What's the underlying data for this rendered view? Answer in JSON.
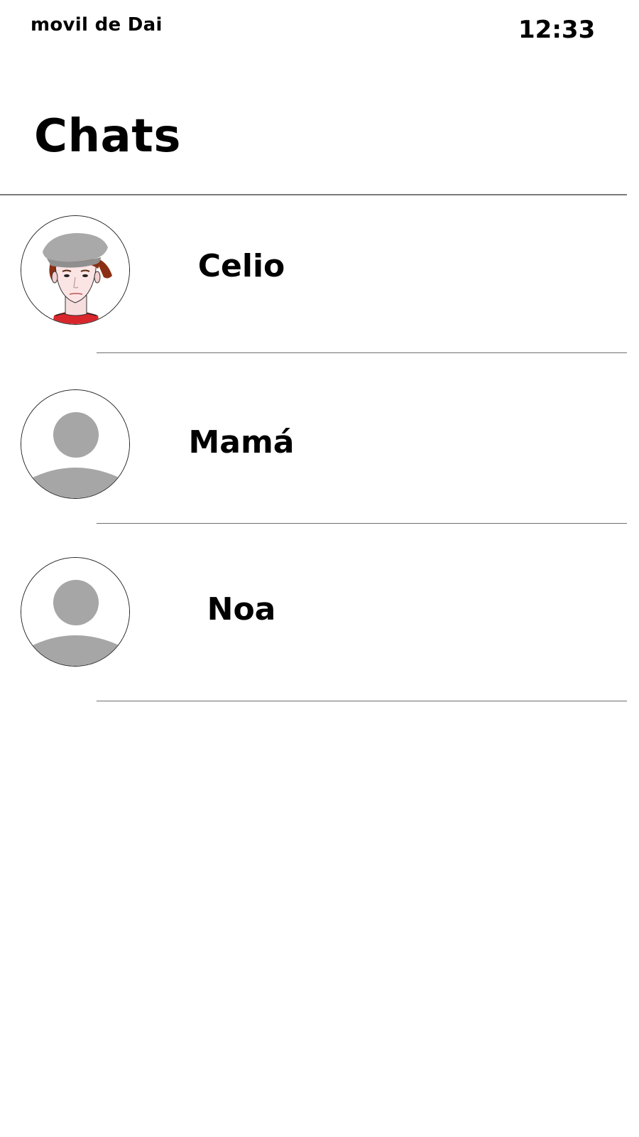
{
  "status_bar": {
    "device_name": "movil de Dai",
    "time": "12:33"
  },
  "header": {
    "title": "Chats"
  },
  "chats": [
    {
      "name": "Celio",
      "avatar": "cartoon-portrait-icon"
    },
    {
      "name": "Mamá",
      "avatar": "default-user-icon"
    },
    {
      "name": "Noa",
      "avatar": "default-user-icon"
    }
  ],
  "colors": {
    "background": "#ffffff",
    "text": "#000000",
    "divider": "#7a7a7a",
    "placeholder_avatar": "#a6a6a6"
  }
}
